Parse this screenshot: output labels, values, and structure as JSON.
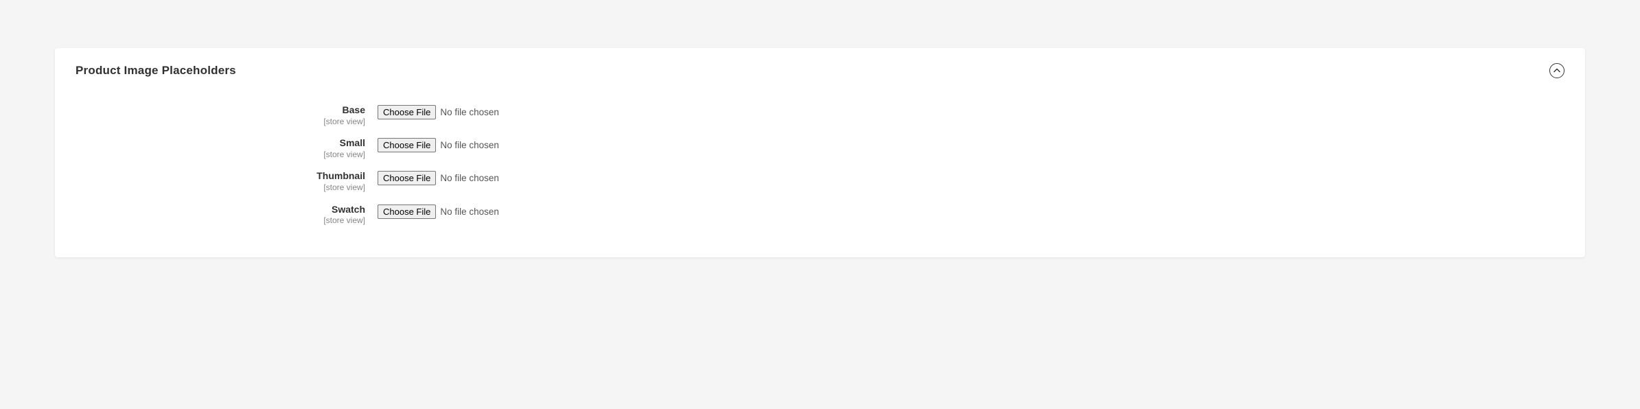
{
  "section": {
    "title": "Product Image Placeholders",
    "scope_label": "[store view]",
    "choose_file_label": "Choose File",
    "no_file_text": "No file chosen",
    "fields": {
      "base": {
        "label": "Base"
      },
      "small": {
        "label": "Small"
      },
      "thumbnail": {
        "label": "Thumbnail"
      },
      "swatch": {
        "label": "Swatch"
      }
    }
  }
}
